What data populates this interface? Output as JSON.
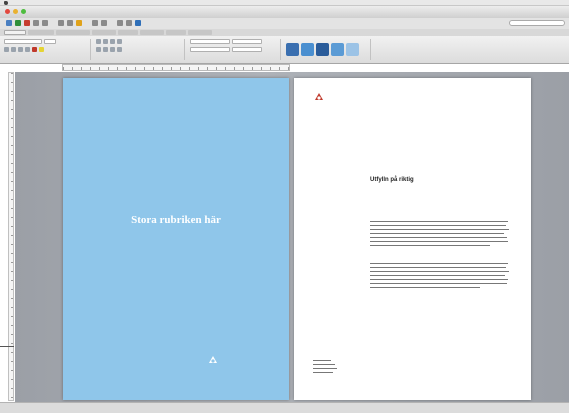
{
  "menubar": {
    "items": [
      "",
      "",
      "",
      "",
      "",
      "",
      "",
      "",
      "",
      "",
      "",
      ""
    ]
  },
  "window": {
    "title": ""
  },
  "toolbar": {
    "search_placeholder": "",
    "button_colors": [
      "#4a7fc1",
      "#2f8f3a",
      "#c63c2e",
      "#8a8a8a",
      "#8a8a8a",
      "#8a8a8a",
      "#8a8a8a",
      "#e0a21a",
      "#8a8a8a",
      "#8a8a8a",
      "#8a8a8a",
      "#8a8a8a",
      "#2f6fb8"
    ]
  },
  "tabs": [
    "",
    "",
    "",
    "",
    "",
    "",
    "",
    ""
  ],
  "ribbon": {
    "font_name": "",
    "font_size": "",
    "style_colors": [
      "#3a6fb0",
      "#4a8fd0",
      "#2a5c9a",
      "#5b9bd5",
      "#9cc3e6",
      "#2e75b6"
    ]
  },
  "cover": {
    "background": "#8fc6ea",
    "top_line": "",
    "title": "Stora rubriken här",
    "subtitle": "",
    "logo_text": ""
  },
  "letter": {
    "logo_text": "",
    "header_right": [
      "",
      "",
      "",
      ""
    ],
    "address_left": [
      "",
      "",
      "",
      ""
    ],
    "address_right": [
      "",
      "",
      "",
      ""
    ],
    "heading": "Utfylln på riktig",
    "lead": "",
    "section1_heading": "",
    "section2_heading": "",
    "signature_name": ""
  },
  "status": {
    "text": ""
  }
}
